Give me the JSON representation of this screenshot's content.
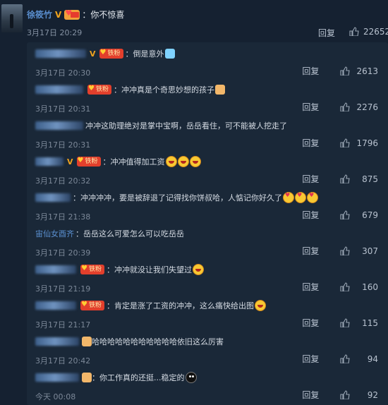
{
  "main_comment": {
    "text": "：你不惊喜",
    "time": "3月17日 20:29",
    "reply_label": "回复",
    "likes": "22652"
  },
  "replies": [
    {
      "text": "：倒是意外",
      "time": "3月17日 20:30",
      "likes": "2613"
    },
    {
      "text": "：冲冲真是个奇思妙想的孩子",
      "time": "3月17日 20:31",
      "likes": "2276"
    },
    {
      "text": "冲冲这助理绝对是掌中宝啊，岳岳看住，可不能被人挖走了",
      "time": "3月17日 20:31",
      "likes": "1796"
    },
    {
      "text": "：冲冲值得加工资",
      "time": "3月17日 20:32",
      "likes": "875"
    },
    {
      "text": "：冲冲冲冲，要是被辞退了记得找你饼叔哈，人惦记你好久了",
      "time": "3月17日 21:38",
      "likes": "679"
    },
    {
      "name": "宙仙女酉齐",
      "text": "：岳岳这么可爱怎么可以吃岳岳",
      "time": "3月17日 20:39",
      "likes": "307"
    },
    {
      "text": "：冲冲就没让我们失望过",
      "time": "3月17日 21:19",
      "likes": "160"
    },
    {
      "text": "：肯定是涨了工资的冲冲，这么痛快给出图",
      "time": "3月17日 21:17",
      "likes": "115"
    },
    {
      "text": "哈哈哈哈哈哈哈哈哈哈哈依旧这么厉害",
      "time": "3月17日 20:42",
      "likes": "94"
    },
    {
      "text": "：你工作真的还挺...稳定的",
      "time": "今天 00:08",
      "likes": "92"
    }
  ],
  "ui": {
    "reply_label": "回复",
    "fan_badge": "铁粉"
  },
  "colors": {
    "background": "#152131",
    "panel": "#1a2838",
    "username": "#eb7350",
    "blue_name": "#5a8fd0"
  }
}
